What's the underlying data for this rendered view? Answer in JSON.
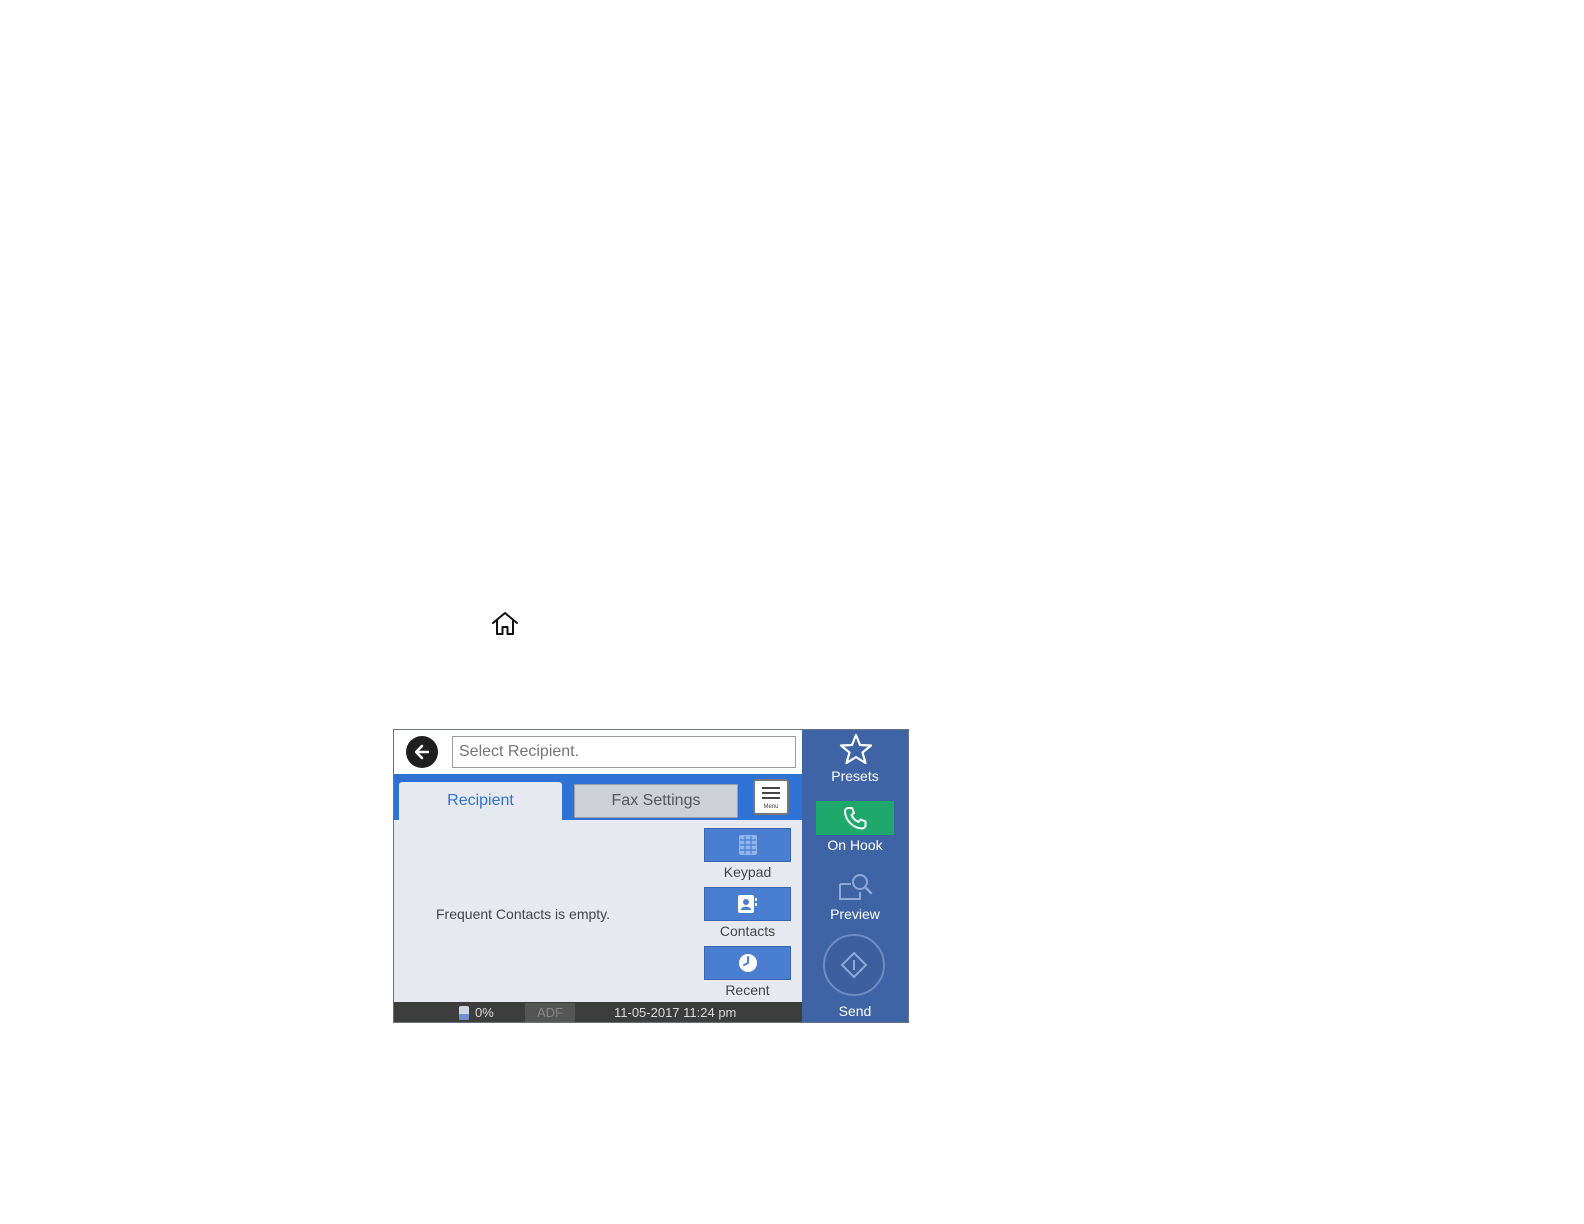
{
  "search": {
    "placeholder": "Select Recipient."
  },
  "tabs": [
    {
      "label": "Recipient",
      "selected": true
    },
    {
      "label": "Fax Settings",
      "selected": false
    }
  ],
  "menu_icon_caption": "Menu",
  "recipient": {
    "empty_message": "Frequent Contacts is empty."
  },
  "side_buttons": [
    {
      "label": "Keypad",
      "icon": "keypad-icon"
    },
    {
      "label": "Contacts",
      "icon": "contacts-icon"
    },
    {
      "label": "Recent",
      "icon": "clock-icon"
    }
  ],
  "right_panel": {
    "presets_label": "Presets",
    "on_hook_label": "On Hook",
    "preview_label": "Preview",
    "send_label": "Send"
  },
  "status_bar": {
    "ink_level": "0%",
    "adf_label": "ADF",
    "datetime": "11-05-2017 11:24 pm"
  },
  "colors": {
    "accent": "#2f72d6",
    "panel": "#3f64a6",
    "on_hook": "#1ea86b"
  }
}
